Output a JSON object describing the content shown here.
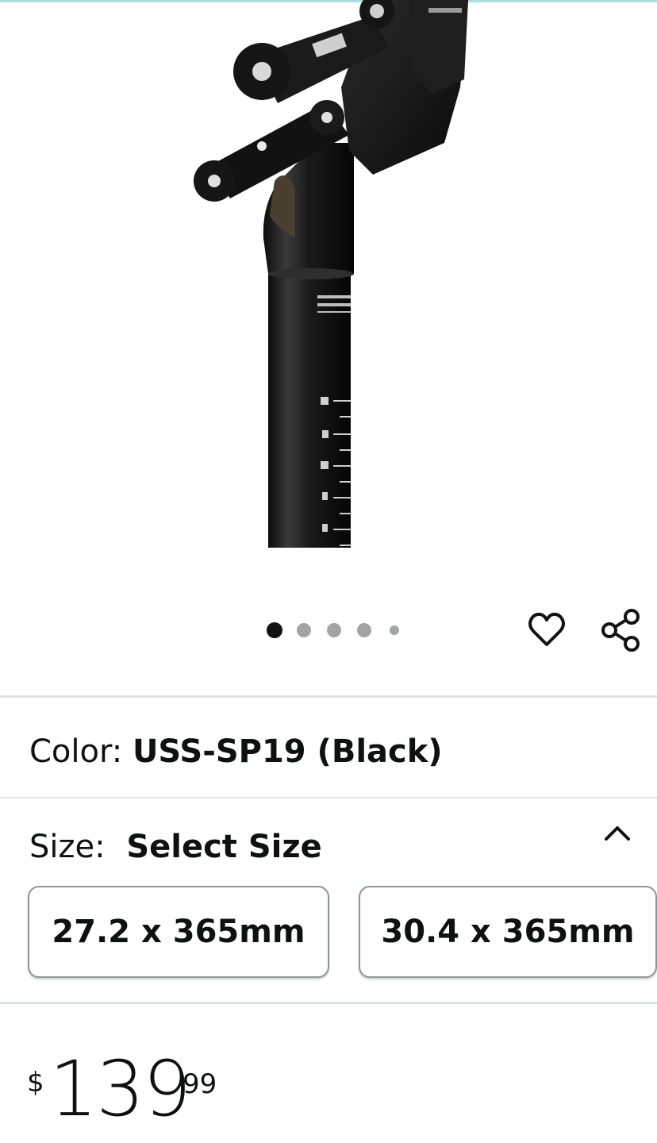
{
  "product": {
    "image_alt": "Suspension seatpost product photo",
    "image_count": 5,
    "active_image_index": 0
  },
  "actions": {
    "wishlist_icon": "heart-icon",
    "share_icon": "share-icon"
  },
  "color": {
    "label": "Color:",
    "value": "USS-SP19 (Black)"
  },
  "size": {
    "label": "Size:",
    "value": "Select Size",
    "toggle_icon": "chevron-up-icon",
    "options": [
      "27.2 x 365mm",
      "30.4 x 365mm"
    ]
  },
  "price": {
    "currency_symbol": "$",
    "whole": "139",
    "fraction": "99"
  },
  "colors": {
    "dot_active": "#111111",
    "dot_inactive": "#a0a4a4",
    "accent_bar": "#a8dfe0"
  }
}
